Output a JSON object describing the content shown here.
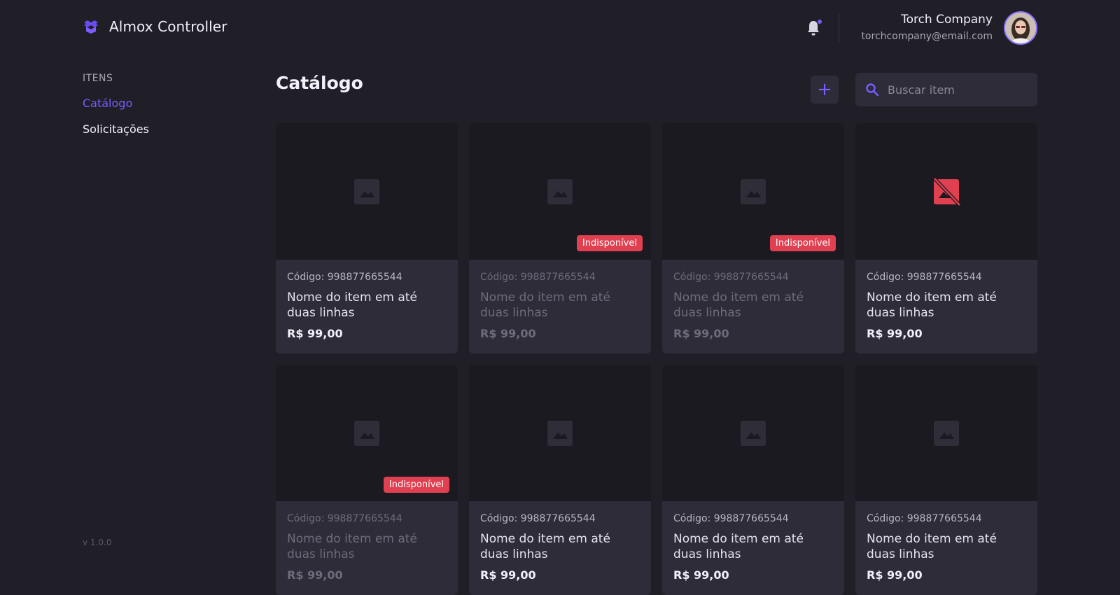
{
  "app": {
    "title": "Almox Controller",
    "version": "v 1.0.0"
  },
  "header": {
    "user_name": "Torch Company",
    "user_email": "torchcompany@email.com"
  },
  "sidebar": {
    "section_label": "ITENS",
    "items": [
      {
        "label": "Catálogo",
        "active": true
      },
      {
        "label": "Solicitações",
        "active": false
      }
    ]
  },
  "main": {
    "title": "Catálogo",
    "add_button": "+",
    "search_placeholder": "Buscar item"
  },
  "cards": [
    {
      "code": "Código: 998877665544",
      "name": "Nome do item em até duas linhas",
      "price": "R$ 99,00",
      "badge": "",
      "image": "image-placeholder",
      "disabled": false
    },
    {
      "code": "Código: 998877665544",
      "name": "Nome do item em até duas linhas",
      "price": "R$ 99,00",
      "badge": "Indisponível",
      "image": "image-placeholder",
      "disabled": true
    },
    {
      "code": "Código: 998877665544",
      "name": "Nome do item em até duas linhas",
      "price": "R$ 99,00",
      "badge": "Indisponível",
      "image": "image-placeholder",
      "disabled": true
    },
    {
      "code": "Código: 998877665544",
      "name": "Nome do item em até duas linhas",
      "price": "R$ 99,00",
      "badge": "",
      "image": "image-unavailable",
      "disabled": false
    },
    {
      "code": "Código: 998877665544",
      "name": "Nome do item em até duas linhas",
      "price": "R$ 99,00",
      "badge": "Indisponível",
      "image": "image-placeholder",
      "disabled": true
    },
    {
      "code": "Código: 998877665544",
      "name": "Nome do item em até duas linhas",
      "price": "R$ 99,00",
      "badge": "",
      "image": "image-placeholder",
      "disabled": false
    },
    {
      "code": "Código: 998877665544",
      "name": "Nome do item em até duas linhas",
      "price": "R$ 99,00",
      "badge": "",
      "image": "image-placeholder",
      "disabled": false
    },
    {
      "code": "Código: 998877665544",
      "name": "Nome do item em até duas linhas",
      "price": "R$ 99,00",
      "badge": "",
      "image": "image-placeholder",
      "disabled": false
    }
  ],
  "colors": {
    "accent": "#7a5cff",
    "danger": "#e04050",
    "background": "#201f28",
    "card": "#2d2c38"
  }
}
